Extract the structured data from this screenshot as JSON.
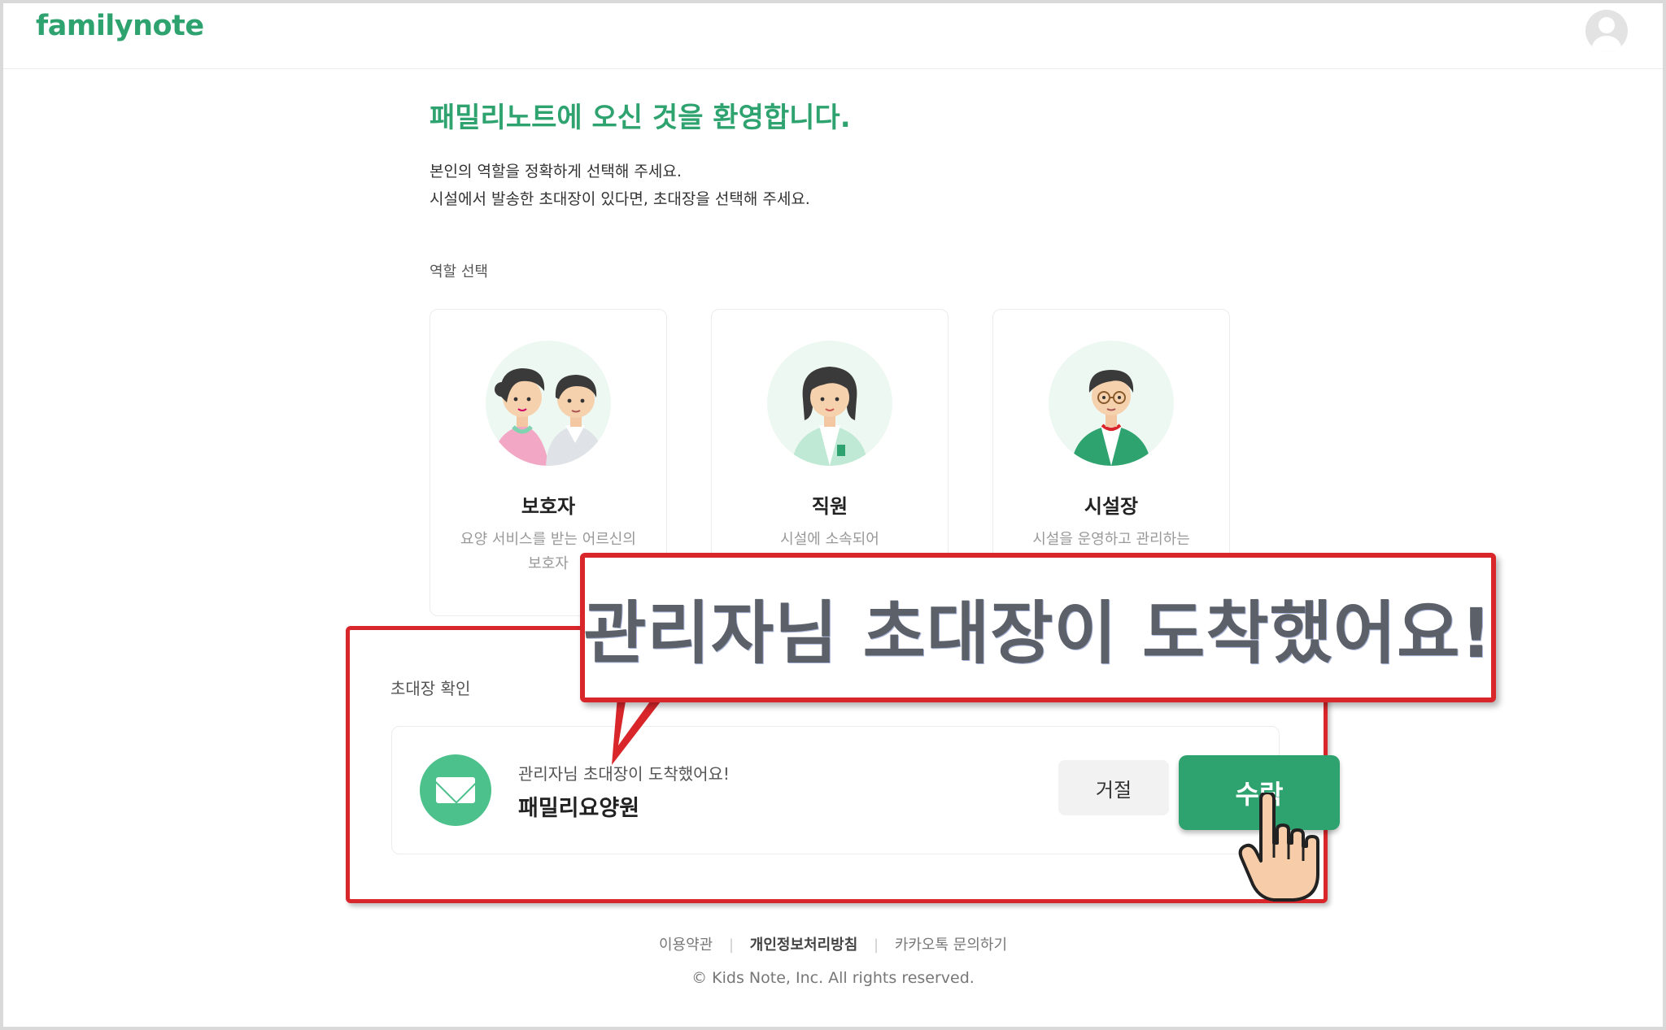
{
  "header": {
    "logo": "familynote",
    "avatar_icon": "user-avatar-icon"
  },
  "welcome": {
    "title": "패밀리노트에 오신 것을 환영합니다.",
    "line1": "본인의 역할을 정확하게 선택해 주세요.",
    "line2": "시설에서 발송한 초대장이 있다면, 초대장을 선택해 주세요."
  },
  "roles": {
    "label": "역할 선택",
    "items": [
      {
        "name": "보호자",
        "desc1": "요양 서비스를 받는 어르신의",
        "desc2": "보호자"
      },
      {
        "name": "직원",
        "desc1": "시설에 소속되어",
        "desc2": ""
      },
      {
        "name": "시설장",
        "desc1": "시설을 운영하고 관리하는",
        "desc2": ""
      }
    ]
  },
  "invite": {
    "label": "초대장 확인",
    "message": "관리자님 초대장이 도착했어요!",
    "facility": "패밀리요양원",
    "reject_label": "거절",
    "accept_label": "수락"
  },
  "callout": {
    "text": "관리자님 초대장이 도착했어요!"
  },
  "footer": {
    "terms": "이용약관",
    "privacy": "개인정보처리방침",
    "contact": "카카오톡 문의하기",
    "copyright": "© Kids Note, Inc. All rights reserved."
  },
  "colors": {
    "brand": "#2ea36f",
    "highlight": "#d8262b"
  }
}
